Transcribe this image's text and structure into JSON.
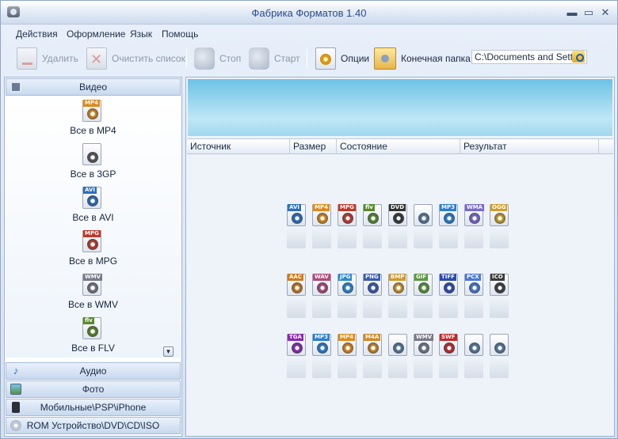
{
  "window": {
    "title": "Фабрика Форматов 1.40",
    "minimize": "▬",
    "maximize": "▭",
    "close": "✕"
  },
  "menu": [
    "Действия",
    "Оформление",
    "Язык",
    "Помощь"
  ],
  "toolbar": {
    "delete": "Удалить",
    "clear_list": "Очистить список",
    "stop": "Стоп",
    "start": "Старт",
    "options": "Опции",
    "dest_folder": "Конечная папка",
    "dest_path": "C:\\Documents and Setti"
  },
  "left_panel": {
    "video_header": "Видео",
    "video_items": [
      "Все в MP4",
      "Все в 3GP",
      "Все в AVI",
      "Все в MPG",
      "Все в WMV",
      "Все в FLV"
    ],
    "video_tags": [
      "MP4",
      "",
      "AVI",
      "MPG",
      "WMV",
      "flv"
    ],
    "categories": [
      "Аудио",
      "Фото",
      "Мобильные\\PSP\\iPhone",
      "ROM Устройство\\DVD\\CD\\ISO"
    ]
  },
  "list": {
    "columns": [
      "Источник",
      "Размер",
      "Состояние",
      "Результат"
    ]
  },
  "format_grid": {
    "rows": [
      [
        "AVI",
        "MP4",
        "MPG",
        "flv",
        "DVD",
        "",
        "MP3",
        "WMA",
        "OGG"
      ],
      [
        "AAC",
        "WAV",
        "JPG",
        "PNG",
        "BMP",
        "GIF",
        "TIFF",
        "PCX",
        "ICO"
      ],
      [
        "TGA",
        "MP3",
        "MP4",
        "M4A",
        "",
        "WMV",
        "SWF",
        "",
        ""
      ]
    ]
  },
  "colors": {
    "accent": "#2a4a8a",
    "banner": "#6cc3e6",
    "tag_colors": {
      "AVI": "#2a6fc0",
      "MP4": "#e08a1a",
      "MPG": "#c0392b",
      "flv": "#5a8a2a",
      "DVD": "#333333",
      "MP3": "#2a7fd0",
      "WMA": "#7a6ad0",
      "OGG": "#d0a02a",
      "AAC": "#d07a1a",
      "WAV": "#b04a7a",
      "JPG": "#2a8ad0",
      "PNG": "#3a5ab0",
      "BMP": "#d09a2a",
      "GIF": "#5a9a3a",
      "TIFF": "#2a4ab0",
      "PCX": "#4a7ad0",
      "ICO": "#3a3a3a",
      "TGA": "#8a2ab0",
      "M4A": "#d08a2a",
      "WMV": "#7a7a8a",
      "SWF": "#c02a2a"
    }
  }
}
